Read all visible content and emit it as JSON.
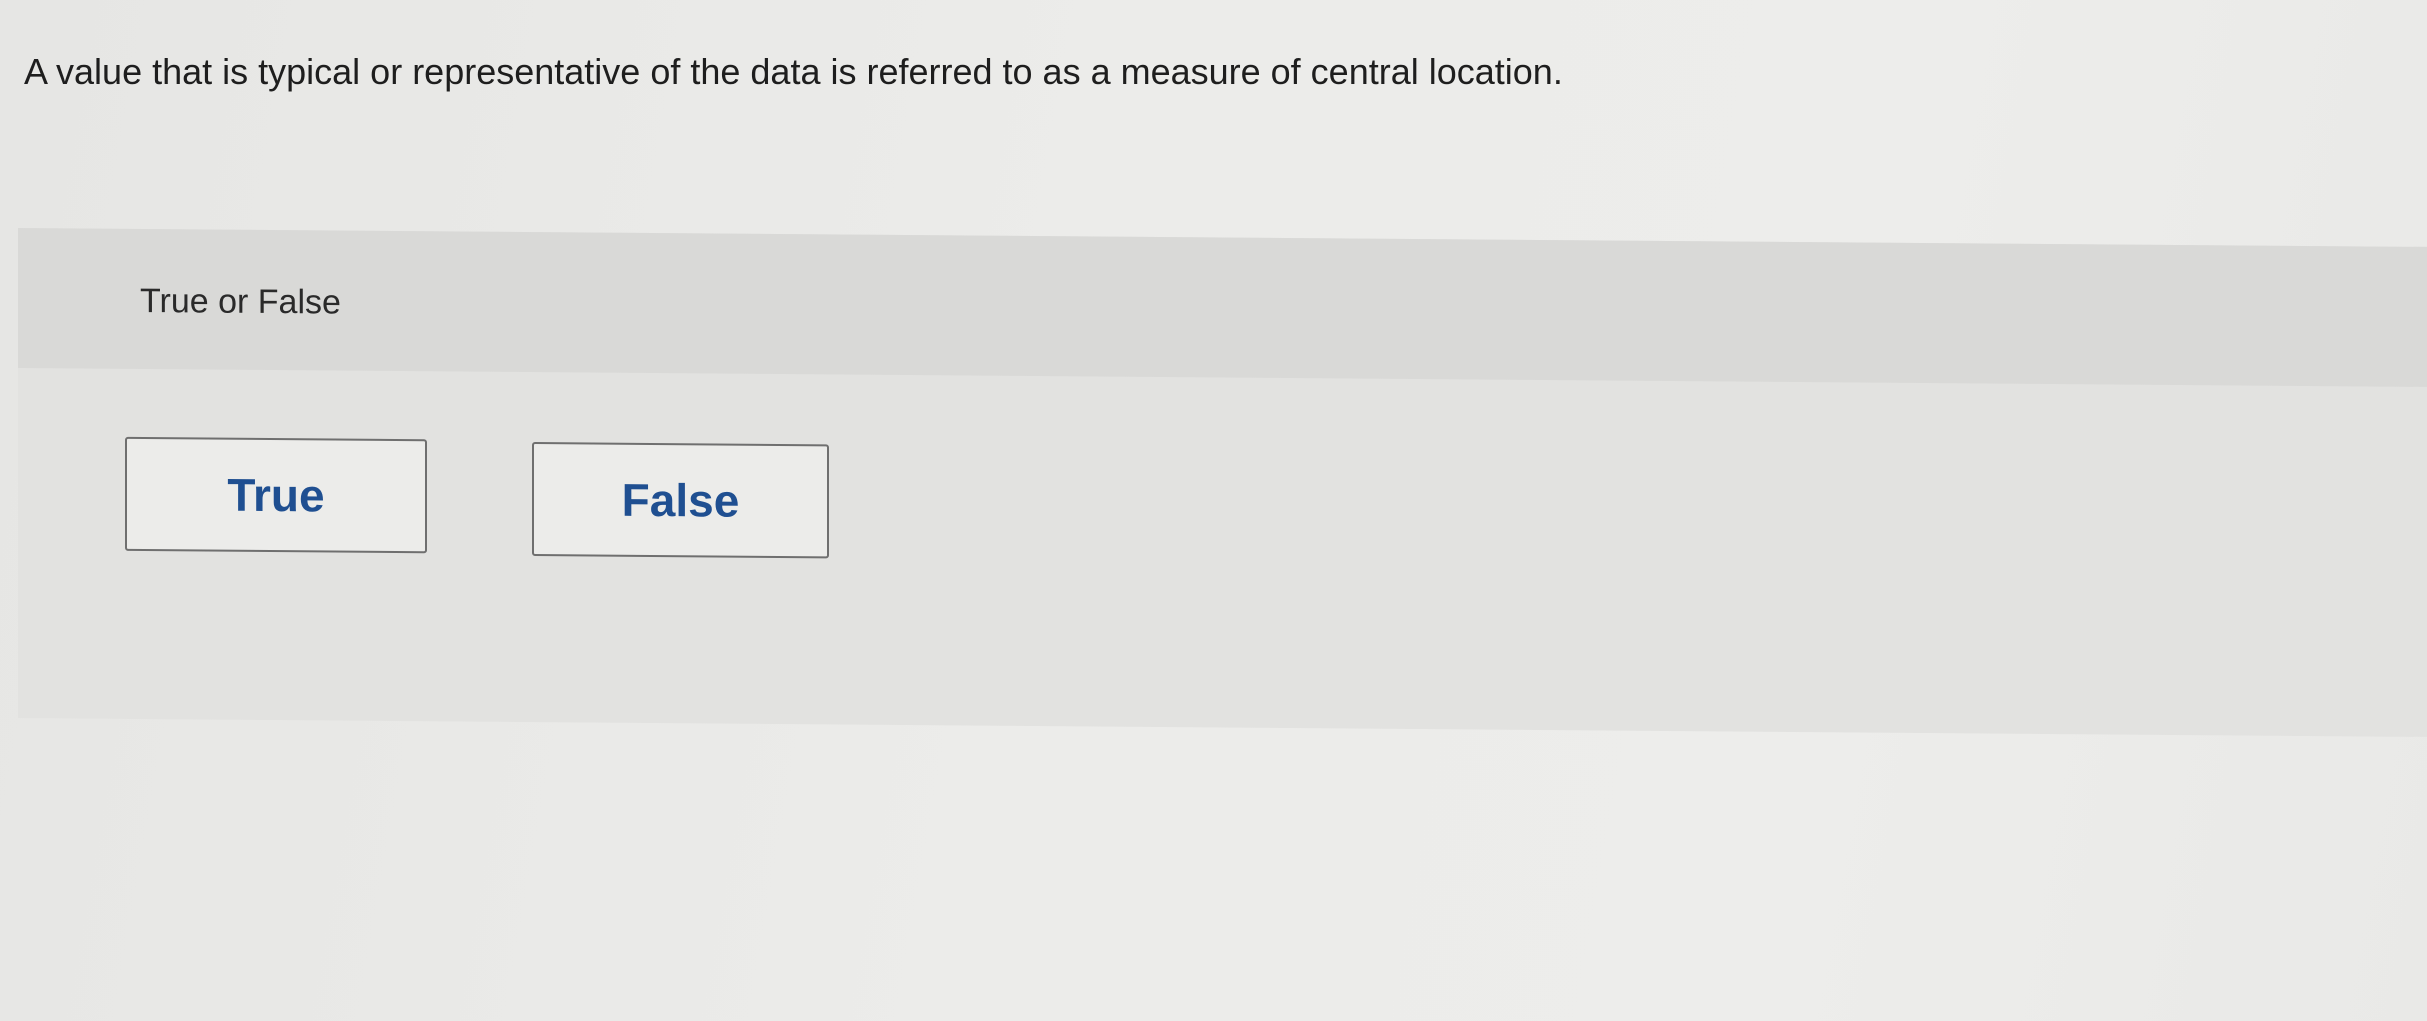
{
  "question": {
    "text": "A value that is typical or representative of the data is referred to as a measure of central location."
  },
  "answer_area": {
    "prompt": "True or False",
    "choices": [
      {
        "label": "True"
      },
      {
        "label": "False"
      }
    ]
  },
  "colors": {
    "choice_text": "#1f4f91",
    "choice_border": "#6f6f6f",
    "panel_background": "#e2e2e0",
    "page_background": "#ececea"
  }
}
